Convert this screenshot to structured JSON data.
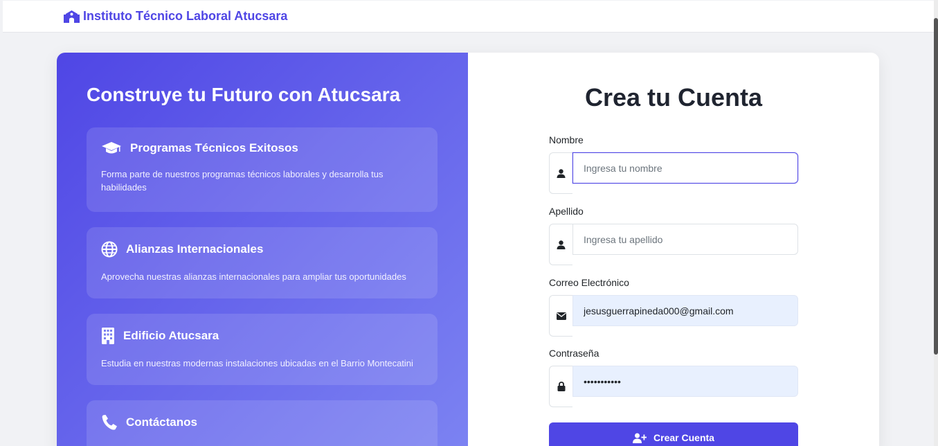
{
  "nav": {
    "brand": "Instituto Técnico Laboral Atucsara",
    "brand_icon": "school-icon"
  },
  "hero": {
    "title": "Construye tu Futuro con Atucsara",
    "features": [
      {
        "icon": "graduation-cap-icon",
        "title": "Programas Técnicos Exitosos",
        "text": "Forma parte de nuestros programas técnicos laborales y desarrolla tus habilidades"
      },
      {
        "icon": "globe-icon",
        "title": "Alianzas Internacionales",
        "text": "Aprovecha nuestras alianzas internacionales para ampliar tus oportunidades"
      },
      {
        "icon": "building-icon",
        "title": "Edificio Atucsara",
        "text": "Estudia en nuestras modernas instalaciones ubicadas en el Barrio Montecatini"
      },
      {
        "icon": "phone-icon",
        "title": "Contáctanos",
        "text": ""
      }
    ]
  },
  "form": {
    "title": "Crea tu Cuenta",
    "fields": {
      "nombre": {
        "label": "Nombre",
        "placeholder": "Ingresa tu nombre",
        "value": "",
        "icon": "user-icon"
      },
      "apellido": {
        "label": "Apellido",
        "placeholder": "Ingresa tu apellido",
        "value": "",
        "icon": "user-icon"
      },
      "correo": {
        "label": "Correo Electrónico",
        "placeholder": "",
        "value": "jesusguerrapineda000@gmail.com",
        "icon": "envelope-icon"
      },
      "password": {
        "label": "Contraseña",
        "placeholder": "",
        "value": "•••••••••••",
        "icon": "lock-icon"
      }
    },
    "submit_label": "Crear Cuenta",
    "submit_icon": "user-plus-icon"
  },
  "colors": {
    "primary": "#4f46e5",
    "gradient_end": "#7c83f2",
    "autofill": "#e8f0fe",
    "heading": "#1f2430"
  }
}
